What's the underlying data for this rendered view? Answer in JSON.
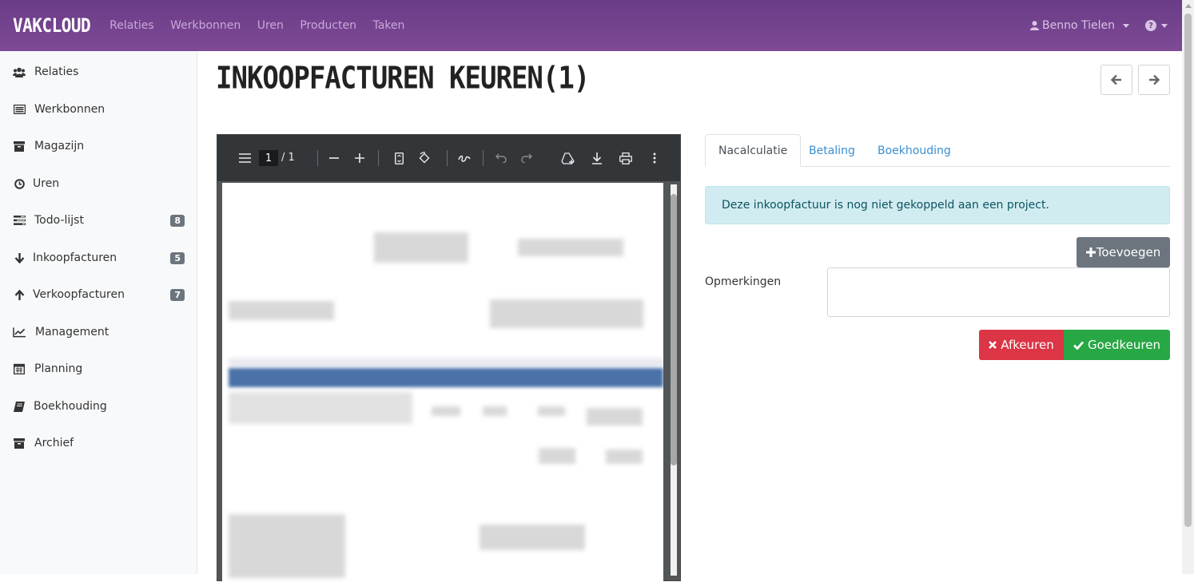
{
  "topbar": {
    "brand": "VAKCLOUD",
    "nav": [
      "Relaties",
      "Werkbonnen",
      "Uren",
      "Producten",
      "Taken"
    ],
    "user": "Benno Tielen",
    "help_icon": "question-circle-icon",
    "colors": {
      "bar": "#7a4693",
      "nav_text": "#c8a8d8"
    }
  },
  "sidebar": {
    "items": [
      {
        "label": "Relaties",
        "icon": "users-icon",
        "badge": ""
      },
      {
        "label": "Werkbonnen",
        "icon": "list-alt-icon",
        "badge": ""
      },
      {
        "label": "Magazijn",
        "icon": "archive-icon",
        "badge": ""
      },
      {
        "label": "Uren",
        "icon": "clock-icon",
        "badge": ""
      },
      {
        "label": "Todo-lijst",
        "icon": "tasks-icon",
        "badge": "8"
      },
      {
        "label": "Inkoopfacturen",
        "icon": "arrow-down-icon",
        "badge": "5"
      },
      {
        "label": "Verkoopfacturen",
        "icon": "arrow-up-icon",
        "badge": "7"
      },
      {
        "label": "Management",
        "icon": "line-chart-icon",
        "badge": ""
      },
      {
        "label": "Planning",
        "icon": "calendar-icon",
        "badge": ""
      },
      {
        "label": "Boekhouding",
        "icon": "book-icon",
        "badge": ""
      },
      {
        "label": "Archief",
        "icon": "archive-icon",
        "badge": ""
      }
    ]
  },
  "main": {
    "title": "INKOOPFACTUREN KEUREN(1)",
    "prev_icon": "arrow-left-icon",
    "next_icon": "arrow-right-icon"
  },
  "pdf_viewer": {
    "current_page": "1",
    "total_pages": "/ 1"
  },
  "panel": {
    "tabs": [
      "Nacalculatie",
      "Betaling",
      "Boekhouding"
    ],
    "active_tab": "Nacalculatie",
    "alert": "Deze inkoopfactuur is nog niet gekoppeld aan een project.",
    "add_button": "Toevoegen",
    "remarks_label": "Opmerkingen",
    "remarks_value": "",
    "reject_button": "Afkeuren",
    "approve_button": "Goedkeuren"
  }
}
